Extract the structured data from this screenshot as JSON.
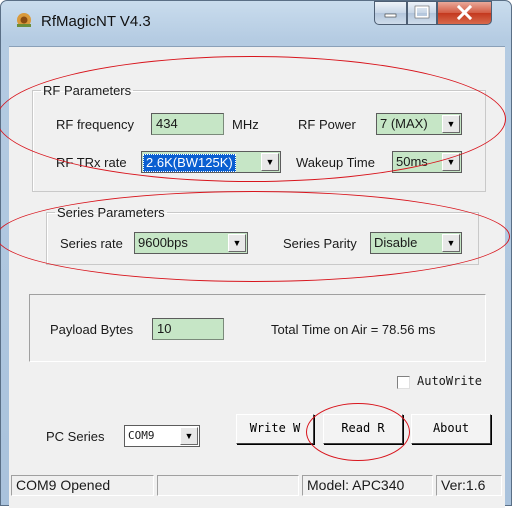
{
  "window": {
    "title": "RfMagicNT V4.3"
  },
  "rf_parameters": {
    "legend": "RF Parameters",
    "frequency_label": "RF frequency",
    "frequency_value": "434",
    "frequency_unit": "MHz",
    "power_label": "RF Power",
    "power_value": "7 (MAX)",
    "trx_rate_label": "RF TRx rate",
    "trx_rate_value": "2.6K(BW125K)",
    "wakeup_label": "Wakeup Time",
    "wakeup_value": "50ms"
  },
  "series_parameters": {
    "legend": "Series  Parameters",
    "rate_label": "Series rate",
    "rate_value": "9600bps",
    "parity_label": "Series Parity",
    "parity_value": "Disable"
  },
  "payload": {
    "label": "Payload Bytes",
    "value": "10",
    "time_on_air": "Total Time on Air  =  78.56 ms"
  },
  "controls": {
    "autowrite_label": "AutoWrite",
    "pc_series_label": "PC Series",
    "pc_series_value": "COM9",
    "write_button": "Write W",
    "read_button": "Read R",
    "about_button": "About"
  },
  "status_bar": {
    "connection": "COM9 Opened",
    "model": "Model: APC340",
    "version": "Ver:1.6"
  },
  "colors": {
    "field_bg": "#c6e6c6",
    "annotation": "#d8151d",
    "selection": "#0a5fd1"
  }
}
